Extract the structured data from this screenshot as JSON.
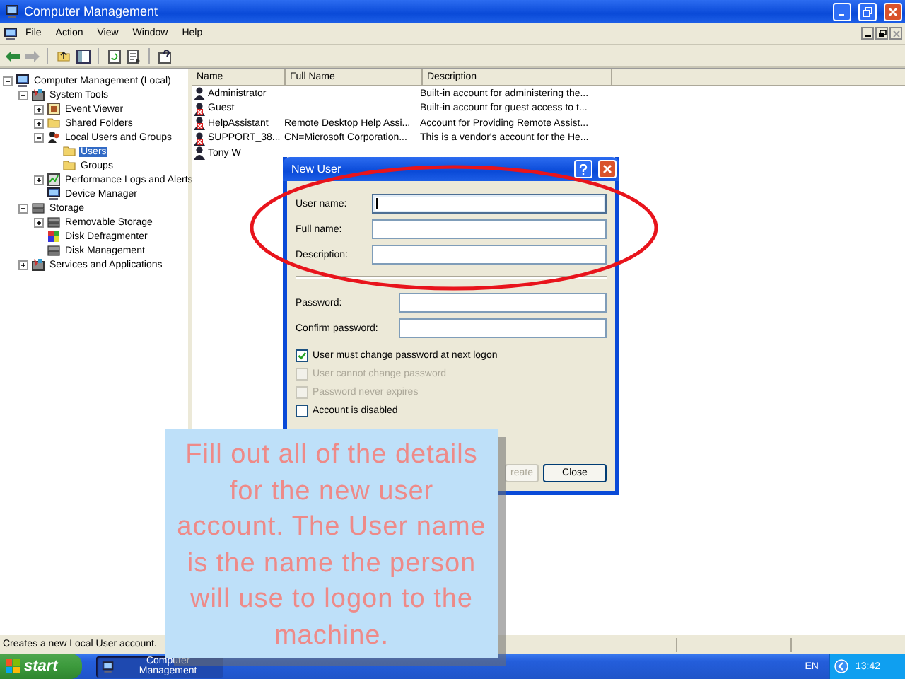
{
  "window": {
    "title": "Computer Management"
  },
  "menu": [
    "File",
    "Action",
    "View",
    "Window",
    "Help"
  ],
  "tree": [
    {
      "label": "Computer Management (Local)",
      "kind": "computer",
      "selected": false,
      "expanded": true,
      "children": [
        {
          "label": "System Tools",
          "kind": "tools",
          "selected": false,
          "expanded": true,
          "children": [
            {
              "label": "Event Viewer",
              "kind": "event",
              "selected": false,
              "expanded": false
            },
            {
              "label": "Shared Folders",
              "kind": "folder",
              "selected": false,
              "expanded": false
            },
            {
              "label": "Local Users and Groups",
              "kind": "users",
              "selected": false,
              "expanded": true,
              "children": [
                {
                  "label": "Users",
                  "kind": "folder",
                  "selected": true
                },
                {
                  "label": "Groups",
                  "kind": "folder",
                  "selected": false
                }
              ]
            },
            {
              "label": "Performance Logs and Alerts",
              "kind": "chart",
              "selected": false,
              "expanded": false
            },
            {
              "label": "Device Manager",
              "kind": "computer",
              "selected": false
            }
          ]
        },
        {
          "label": "Storage",
          "kind": "storage",
          "selected": false,
          "expanded": true,
          "children": [
            {
              "label": "Removable Storage",
              "kind": "storage",
              "selected": false,
              "expanded": false
            },
            {
              "label": "Disk Defragmenter",
              "kind": "disk",
              "selected": false
            },
            {
              "label": "Disk Management",
              "kind": "storage",
              "selected": false
            }
          ]
        },
        {
          "label": "Services and Applications",
          "kind": "tools",
          "selected": false,
          "expanded": false
        }
      ]
    }
  ],
  "users": {
    "columns": [
      "Name",
      "Full Name",
      "Description"
    ],
    "rows": [
      {
        "name": "Administrator",
        "description": "Built-in account for administering the...",
        "disabled": false
      },
      {
        "name": "Guest",
        "description": "Built-in account for guest access to t...",
        "disabled": true
      },
      {
        "name": "HelpAssistant",
        "full_name": "Remote Desktop Help Assi...",
        "description": "Account for Providing Remote Assist...",
        "disabled": true
      },
      {
        "name": "SUPPORT_38...",
        "full_name": "CN=Microsoft Corporation...",
        "description": "This is a vendor's account for the He...",
        "disabled": true
      },
      {
        "name": "Tony W",
        "disabled": false
      }
    ]
  },
  "dialog": {
    "title": "New User",
    "fields": [
      {
        "label": "User name:",
        "focused": true
      },
      {
        "label": "Full name:",
        "focused": false
      },
      {
        "label": "Description:",
        "focused": false
      }
    ],
    "password_fields": [
      {
        "label": "Password:"
      },
      {
        "label": "Confirm password:"
      }
    ],
    "checkboxes": [
      {
        "label": "User must change password at next logon",
        "checked": true,
        "disabled": false
      },
      {
        "label": "User cannot change password",
        "checked": false,
        "disabled": true
      },
      {
        "label": "Password never expires",
        "checked": false,
        "disabled": true
      },
      {
        "label": "Account is disabled",
        "checked": false,
        "disabled": false
      }
    ],
    "buttons": [
      {
        "label": "reate",
        "disabled": true
      },
      {
        "label": "Close",
        "disabled": false
      }
    ]
  },
  "callout": {
    "text": "Fill out all of the details for the new user account. The User name is the name the person will use to logon to the machine."
  },
  "status_bar": {
    "text": "Creates a new Local User account."
  },
  "taskbar": {
    "start": "start",
    "tasks": [
      {
        "label": "Computer Management",
        "selected": true
      }
    ],
    "language": "EN",
    "clock": "13:42"
  }
}
